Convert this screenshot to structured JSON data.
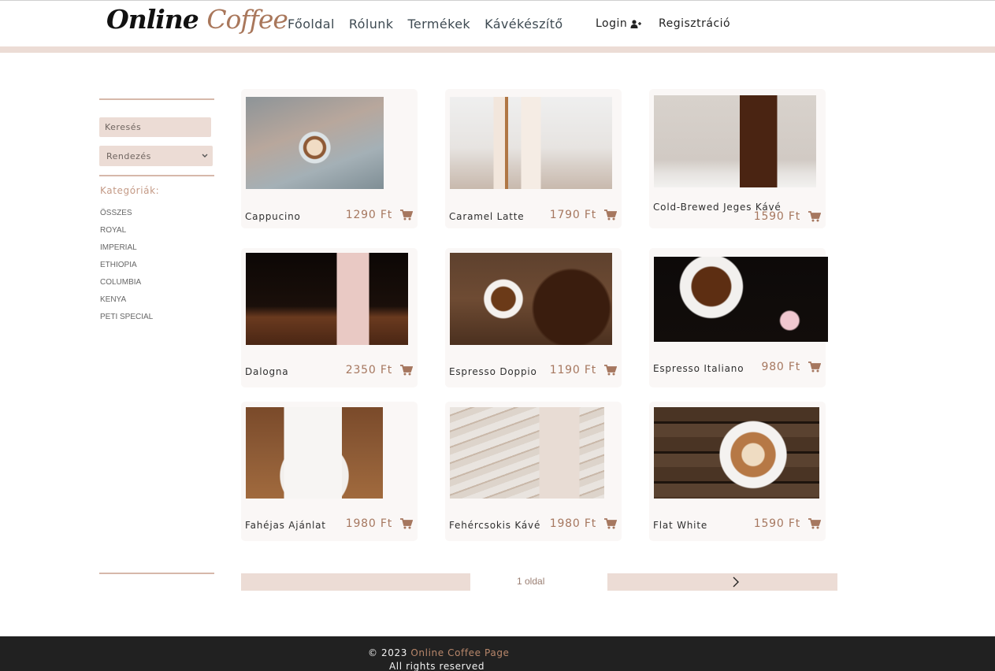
{
  "header": {
    "logo_part1": "Online",
    "logo_part2": "Coffee",
    "nav": [
      "Főoldal",
      "Rólunk",
      "Termékek",
      "Kávékészítő"
    ],
    "login_label": "Login",
    "login_icon": "user-plus-icon",
    "register_label": "Regisztráció"
  },
  "sidebar": {
    "search_placeholder": "Keresés",
    "sort_label": "Rendezés",
    "categories_title": "Kategóriák:",
    "categories": [
      "ÖSSZES",
      "ROYAL",
      "IMPERIAL",
      "ETHIOPIA",
      "COLUMBIA",
      "KENYA",
      "PETI SPECIAL"
    ]
  },
  "products": [
    {
      "name": "Cappucino",
      "price": "1290 Ft"
    },
    {
      "name": "Caramel Latte",
      "price": "1790 Ft"
    },
    {
      "name": "Cold-Brewed Jeges Kávé",
      "price": "1590 Ft"
    },
    {
      "name": "Dalogna",
      "price": "2350 Ft"
    },
    {
      "name": "Espresso Doppio",
      "price": "1190 Ft"
    },
    {
      "name": "Espresso Italiano",
      "price": "980 Ft"
    },
    {
      "name": "Fahéjas Ajánlat",
      "price": "1980 Ft"
    },
    {
      "name": "Fehércsokis Kávé",
      "price": "1980 Ft"
    },
    {
      "name": "Flat White",
      "price": "1590 Ft"
    }
  ],
  "pagination": {
    "label": "1 oldal",
    "next_icon": "chevron-right-icon"
  },
  "footer": {
    "copyright": "© 2023",
    "brand": "Online Coffee Page",
    "rights": "All rights reserved"
  },
  "colors": {
    "accent": "#a9775b",
    "strip": "#ecdcd5",
    "footer_bg": "#212121"
  }
}
